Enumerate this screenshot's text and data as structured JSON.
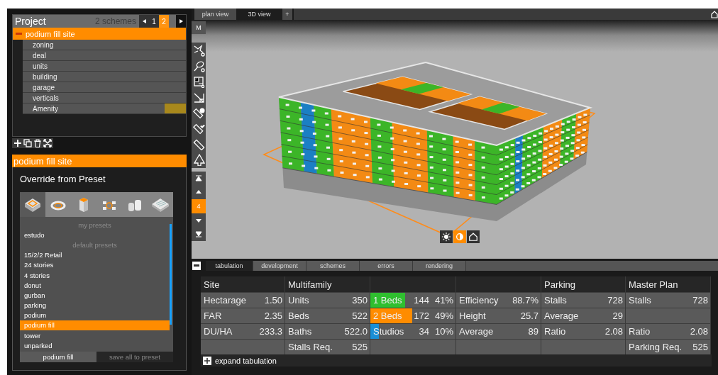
{
  "project": {
    "title": "Project",
    "scheme_count": "2 schemes",
    "pages": [
      {
        "label": "1",
        "selected": false
      },
      {
        "label": "2",
        "selected": true
      }
    ],
    "tree": {
      "label": "podium fill site",
      "selected": true,
      "expanded": true,
      "children": [
        {
          "label": "zoning",
          "selected": false
        },
        {
          "label": "deal",
          "selected": false
        },
        {
          "label": "units",
          "selected": false
        },
        {
          "label": "building",
          "selected": false
        },
        {
          "label": "garage",
          "selected": false
        },
        {
          "label": "verticals",
          "selected": false
        },
        {
          "label": "Amenity",
          "selected": false,
          "color": "#a8881c"
        }
      ]
    }
  },
  "site_panel": {
    "title": "podium fill site",
    "heading": "Override from Preset",
    "preset_types": [
      {
        "kind": "block",
        "selected": true
      },
      {
        "kind": "ring",
        "selected": false
      },
      {
        "kind": "tower",
        "selected": false
      },
      {
        "kind": "cluster",
        "selected": false
      },
      {
        "kind": "cylinders",
        "selected": false
      },
      {
        "kind": "slab",
        "selected": false
      }
    ],
    "presets": [
      {
        "kind": "header",
        "label": "my presets"
      },
      {
        "kind": "item",
        "label": "estudo",
        "selected": false
      },
      {
        "kind": "header",
        "label": "default presets"
      },
      {
        "kind": "item",
        "label": "15/2/2 Retail",
        "selected": false
      },
      {
        "kind": "item",
        "label": "24 stories",
        "selected": false
      },
      {
        "kind": "item",
        "label": "4 stories",
        "selected": false
      },
      {
        "kind": "item",
        "label": "donut",
        "selected": false
      },
      {
        "kind": "item",
        "label": "gurban",
        "selected": false
      },
      {
        "kind": "item",
        "label": "parking",
        "selected": false
      },
      {
        "kind": "item",
        "label": "podium",
        "selected": false
      },
      {
        "kind": "item",
        "label": "podium fill",
        "selected": true
      },
      {
        "kind": "item",
        "label": "tower",
        "selected": false
      },
      {
        "kind": "item",
        "label": "unparked",
        "selected": false
      }
    ],
    "current_preset": "podium fill",
    "save_label": "save all to preset"
  },
  "view_tabs": [
    {
      "label": "plan view",
      "selected": false
    },
    {
      "label": "3D view",
      "selected": true
    },
    {
      "label": "+",
      "selected": false
    }
  ],
  "mode_button": "M",
  "floor": "4",
  "view_modes": [
    {
      "kind": "sun",
      "selected": false
    },
    {
      "kind": "contrast",
      "selected": true
    },
    {
      "kind": "home",
      "selected": false
    }
  ],
  "bottom_tabs": [
    {
      "label": "tabulation",
      "selected": true
    },
    {
      "label": "development",
      "selected": false
    },
    {
      "label": "schemes",
      "selected": false
    },
    {
      "label": "errors",
      "selected": false
    },
    {
      "label": "rendering",
      "selected": false
    }
  ],
  "tabulation": {
    "groups": [
      {
        "title": "Site",
        "rows": [
          {
            "kind": "metric",
            "label": "Hectarage",
            "value": "1.50"
          },
          {
            "kind": "metric",
            "label": "FAR",
            "value": "2.35"
          },
          {
            "kind": "metric",
            "label": "DU/HA",
            "value": "233.3"
          },
          {
            "kind": "blank"
          }
        ]
      },
      {
        "title": "Multifamily",
        "rows": [
          {
            "kind": "metric",
            "label": "Units",
            "value": "350"
          },
          {
            "kind": "metric",
            "label": "Beds",
            "value": "522"
          },
          {
            "kind": "metric",
            "label": "Baths",
            "value": "522.0"
          },
          {
            "kind": "metric",
            "label": "Stalls Req.",
            "value": "525"
          }
        ]
      },
      {
        "rows": [
          {
            "kind": "mix",
            "label": "1 Beds",
            "count": "144",
            "percent": "41%",
            "color": "#2fbf2f",
            "level": 0.41
          },
          {
            "kind": "mix",
            "label": "2 Beds",
            "count": "172",
            "percent": "49%",
            "color": "#ff8c00",
            "level": 0.49
          },
          {
            "kind": "mix",
            "label": "Studios",
            "count": "34",
            "percent": "10%",
            "color": "#1a8fd6",
            "level": 0.1
          },
          {
            "kind": "blank"
          }
        ]
      },
      {
        "rows": [
          {
            "kind": "metric",
            "label": "Efficiency",
            "value": "88.7%"
          },
          {
            "kind": "metric",
            "label": "Height",
            "value": "25.7"
          },
          {
            "kind": "metric",
            "label": "Average",
            "value": "89"
          },
          {
            "kind": "blank"
          }
        ]
      },
      {
        "title": "Parking",
        "rows": [
          {
            "kind": "metric",
            "label": "Stalls",
            "value": "728"
          },
          {
            "kind": "metric",
            "label": "Average",
            "value": "29"
          },
          {
            "kind": "metric",
            "label": "Ratio",
            "value": "2.08"
          },
          {
            "kind": "blank"
          }
        ]
      },
      {
        "title": "Master Plan",
        "rows": [
          {
            "kind": "metric",
            "label": "Stalls",
            "value": "728"
          },
          {
            "kind": "blank"
          },
          {
            "kind": "metric",
            "label": "Ratio",
            "value": "2.08"
          },
          {
            "kind": "metric",
            "label": "Parking Req.",
            "value": "525"
          }
        ]
      }
    ],
    "expand_label": "expand tabulation"
  }
}
